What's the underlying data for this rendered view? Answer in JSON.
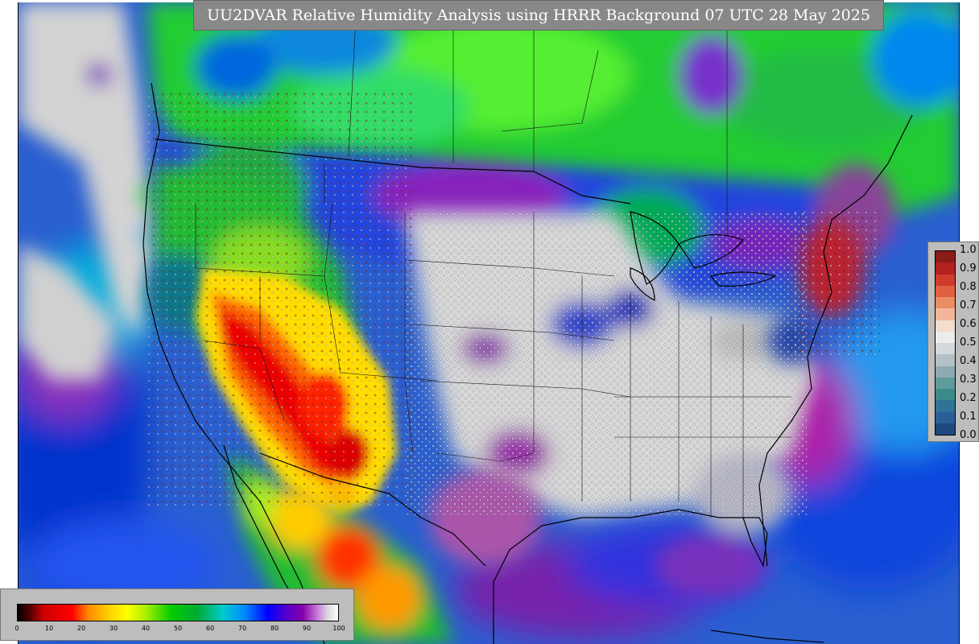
{
  "title": "UU2DVAR Relative Humidity Analysis using HRRR Background 07 UTC 28 May 2025",
  "legend_right": {
    "ticks": [
      "1.0",
      "0.9",
      "0.8",
      "0.7",
      "0.6",
      "0.5",
      "0.4",
      "0.3",
      "0.2",
      "0.1",
      "0.0"
    ],
    "colors": [
      "#8b1a1a",
      "#b22020",
      "#d03a2a",
      "#e06040",
      "#ea8c64",
      "#f2b79a",
      "#f4dccf",
      "#ececec",
      "#d3d8da",
      "#b3c1c6",
      "#8eaab0",
      "#5f9b9a",
      "#3d8a8a",
      "#2f7396",
      "#2a5f95",
      "#1f4a80"
    ]
  },
  "legend_bottom": {
    "ticks": [
      "0",
      "10",
      "20",
      "30",
      "40",
      "50",
      "60",
      "70",
      "80",
      "90",
      "100"
    ]
  },
  "colors": {
    "ocean": "#3366cc",
    "canada": "#22cc33",
    "land_dry": "#dcdcdc",
    "desert": "#ff3300",
    "title_bg": "#888888"
  }
}
